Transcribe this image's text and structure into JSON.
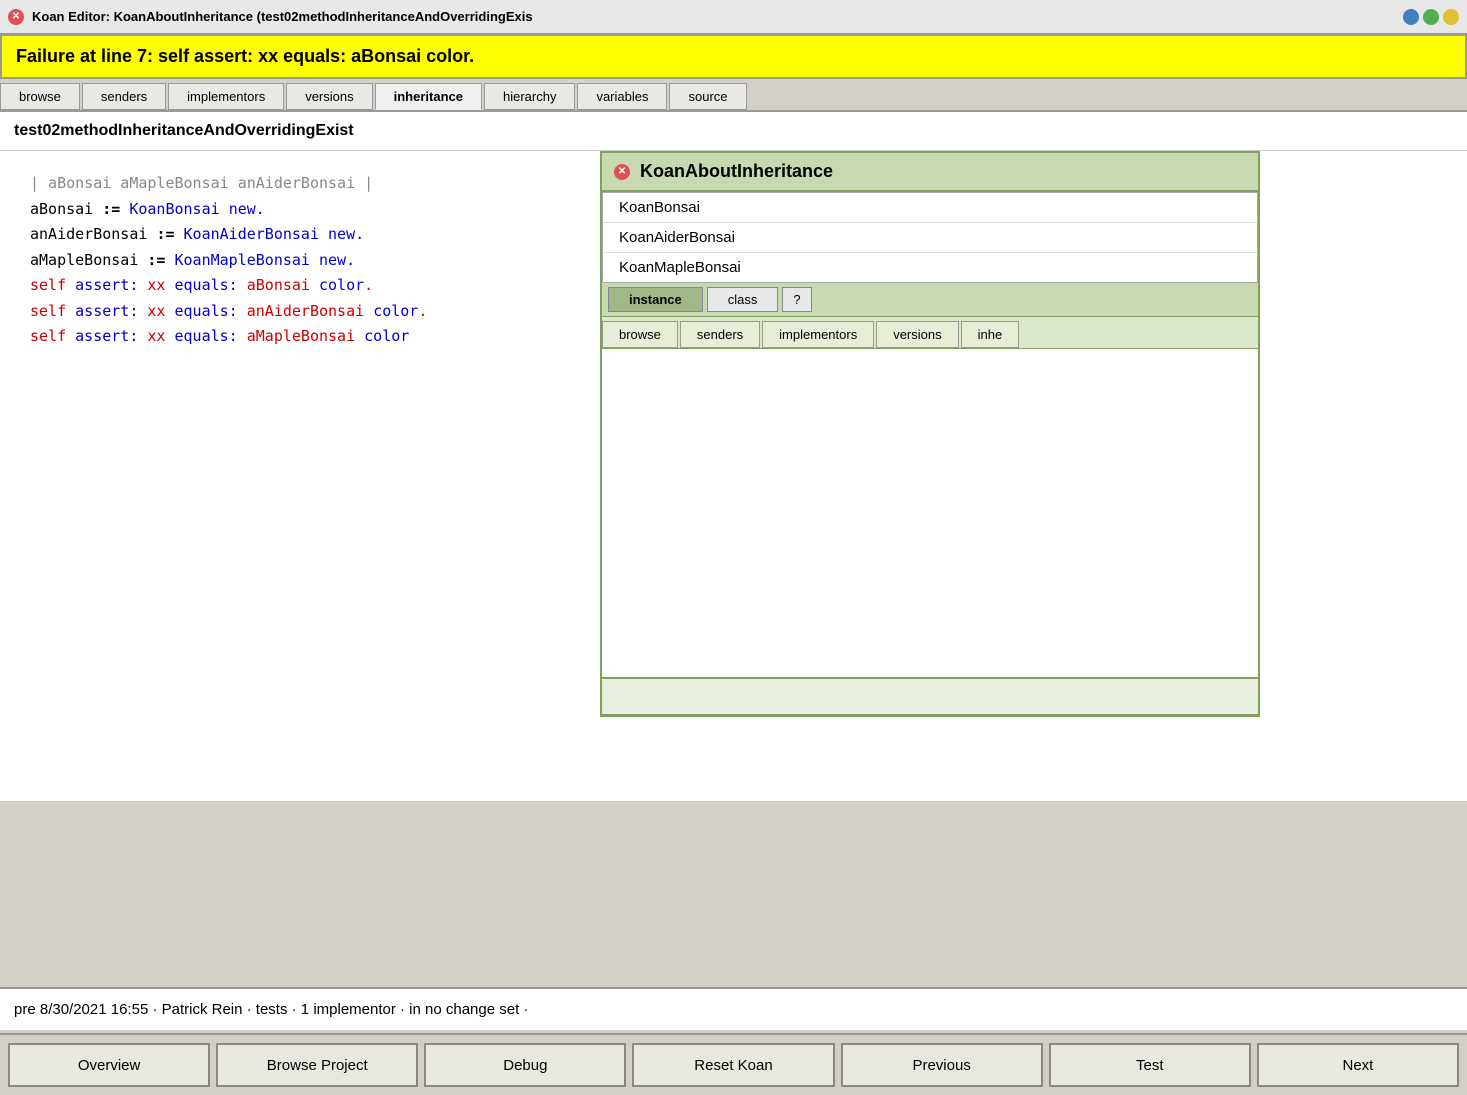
{
  "titlebar": {
    "text": "Koan Editor: KoanAboutInheritance (test02methodInheritanceAndOverridingExis",
    "close_label": "✕"
  },
  "failure": {
    "text": "Failure at line 7:    self assert: xx equals: aBonsai color."
  },
  "tabs": [
    {
      "label": "browse",
      "active": false
    },
    {
      "label": "senders",
      "active": false
    },
    {
      "label": "implementors",
      "active": false
    },
    {
      "label": "versions",
      "active": false
    },
    {
      "label": "inheritance",
      "active": true
    },
    {
      "label": "hierarchy",
      "active": false
    },
    {
      "label": "variables",
      "active": false
    },
    {
      "label": "source",
      "active": false
    }
  ],
  "method_title": "test02methodInheritanceAndOverridingExist",
  "code": {
    "line1": "| aBonsai aMapleBonsai anAiderBonsai |",
    "line2_var": "aBonsai",
    "line2_assign": ":=",
    "line2_class": "KoanBonsai",
    "line2_kw": "new.",
    "line3_var": "anAiderBonsai",
    "line3_assign": ":=",
    "line3_class": "KoanAiderBonsai",
    "line3_kw": "new.",
    "line4_var": "aMapleBonsai",
    "line4_assign": ":=",
    "line4_class": "KoanMapleBonsai",
    "line4_kw": "new.",
    "line5": "self assert: xx equals: aBonsai color.",
    "line6": "self assert: xx equals: anAiderBonsai color.",
    "line7": "self assert: xx equals: aMapleBonsai color"
  },
  "float_panel": {
    "title": "KoanAboutInheritance",
    "classes": [
      {
        "name": "KoanBonsai"
      },
      {
        "name": "KoanAiderBonsai"
      },
      {
        "name": "KoanMapleBonsai"
      }
    ],
    "instance_btn": "instance",
    "class_btn": "class",
    "question_btn": "?",
    "sub_tabs": [
      {
        "label": "browse",
        "active": false
      },
      {
        "label": "senders",
        "active": false
      },
      {
        "label": "implementors",
        "active": false
      },
      {
        "label": "versions",
        "active": false
      },
      {
        "label": "inhe",
        "active": false
      }
    ]
  },
  "status_bar": {
    "text": "pre 8/30/2021 16:55 · Patrick Rein · tests · 1 implementor · in no change set ·"
  },
  "bottom_buttons": [
    {
      "label": "Overview"
    },
    {
      "label": "Browse Project"
    },
    {
      "label": "Debug"
    },
    {
      "label": "Reset Koan"
    },
    {
      "label": "Previous"
    },
    {
      "label": "Test"
    },
    {
      "label": "Next"
    }
  ]
}
